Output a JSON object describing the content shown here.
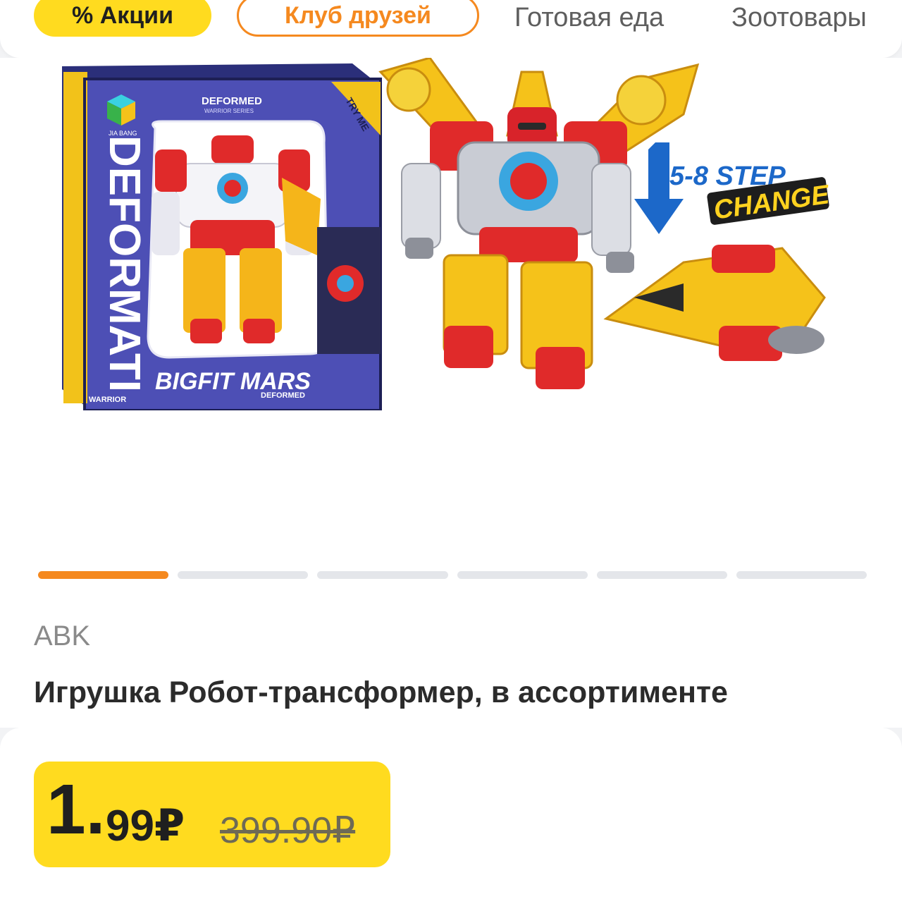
{
  "topbar": {
    "chips": [
      {
        "label": "% Акции",
        "color": "#ffdb1f"
      },
      {
        "label": "Клуб друзей",
        "color": "#f5891f"
      }
    ],
    "categories": [
      "Готовая еда",
      "Зоотовары"
    ]
  },
  "product": {
    "brand": "ABK",
    "title": "Игрушка Робот-трансформер, в ассортименте",
    "image_texts": {
      "box_series": "DEFORMED",
      "box_subseries": "WARRIOR SERIES",
      "box_side": "DEFORMATI",
      "box_try": "TRY ME",
      "box_logo": "BIGFIT MARS",
      "box_logo_sub": "DEFORMED",
      "box_warrior": "WARRIOR",
      "box_maker": "JIA BANG",
      "step_text": "5-8 STEP",
      "change_text": "CHANGE"
    }
  },
  "gallery": {
    "total_slides": 6,
    "active_index": 0,
    "active_color": "#f5891f"
  },
  "price": {
    "integer": "1.",
    "decimal": "99₽",
    "old": "399.90₽",
    "badge_color": "#ffdb1f"
  }
}
